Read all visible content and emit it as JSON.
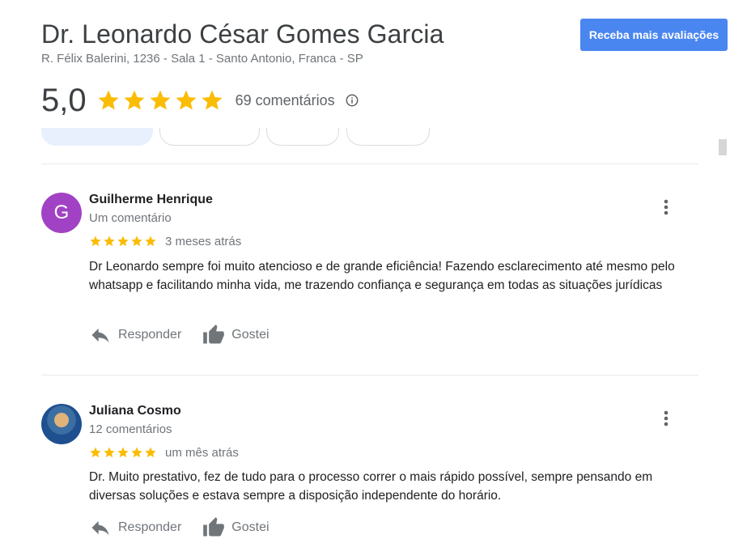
{
  "header": {
    "title": "Dr. Leonardo César Gomes Garcia",
    "address": "R. Félix Balerini, 1236 - Sala 1 - Santo Antonio, Franca - SP",
    "cta_label": "Receba mais avaliações",
    "rating_value": "5,0",
    "rating_stars": 5,
    "review_count": "69 comentários",
    "info_icon": "info-icon"
  },
  "colors": {
    "accent": "#4a86f0",
    "star": "#fbbc04",
    "avatar_letter_bg": "#a142c4"
  },
  "reviews": [
    {
      "avatar_letter": "G",
      "name": "Guilherme Henrique",
      "sub": "Um comentário",
      "stars": 5,
      "date": "3 meses atrás",
      "text": "Dr Leonardo sempre foi muito atencioso e de grande eficiência! Fazendo esclarecimento até mesmo pelo whatsapp e facilitando minha vida, me trazendo confiança e segurança em todas as situações jurídicas",
      "reply_label": "Responder",
      "like_label": "Gostei"
    },
    {
      "avatar_letter": "",
      "name": "Juliana Cosmo",
      "sub": "12 comentários",
      "stars": 5,
      "date": "um mês atrás",
      "text": "Dr. Muito prestativo, fez de tudo para o processo correr o mais rápido possível, sempre pensando em diversas soluções e estava sempre a disposição independente do horário.",
      "reply_label": "Responder",
      "like_label": "Gostei"
    }
  ]
}
